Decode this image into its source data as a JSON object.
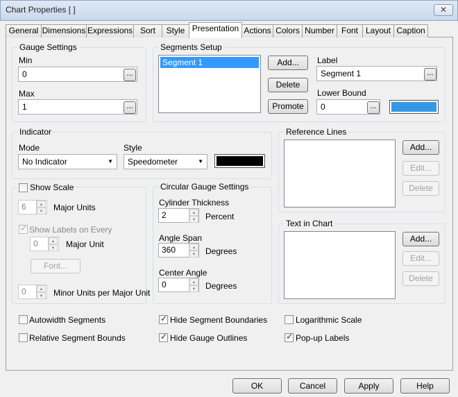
{
  "window": {
    "title": "Chart Properties [ ]",
    "close_label": "✕"
  },
  "tabs": [
    {
      "label": "General"
    },
    {
      "label": "Dimensions"
    },
    {
      "label": "Expressions"
    },
    {
      "label": "Sort"
    },
    {
      "label": "Style"
    },
    {
      "label": "Presentation",
      "selected": true
    },
    {
      "label": "Actions"
    },
    {
      "label": "Colors"
    },
    {
      "label": "Number"
    },
    {
      "label": "Font"
    },
    {
      "label": "Layout"
    },
    {
      "label": "Caption"
    }
  ],
  "gauge_settings": {
    "title": "Gauge Settings",
    "min_label": "Min",
    "min_value": "0",
    "max_label": "Max",
    "max_value": "1",
    "ellipsis": "..."
  },
  "segments": {
    "title": "Segments Setup",
    "items": [
      "Segment 1"
    ],
    "add": "Add...",
    "delete": "Delete",
    "promote": "Promote",
    "label_label": "Label",
    "label_value": "Segment 1",
    "lower_bound_label": "Lower Bound",
    "lower_bound_value": "0",
    "segment_color": "#3399e6"
  },
  "indicator": {
    "title": "Indicator",
    "mode_label": "Mode",
    "mode_value": "No Indicator",
    "style_label": "Style",
    "style_value": "Speedometer",
    "color": "#000000"
  },
  "reference_lines": {
    "title": "Reference Lines",
    "add": "Add...",
    "edit": "Edit...",
    "delete": "Delete"
  },
  "scale": {
    "title": "Show Scale",
    "checked": false,
    "major_units_value": "6",
    "major_units_label": "Major Units",
    "show_labels_label": "Show Labels on Every",
    "show_labels_checked": true,
    "major_unit_value": "0",
    "major_unit_label": "Major Unit",
    "font_button": "Font...",
    "minor_value": "0",
    "minor_label": "Minor Units per Major Unit"
  },
  "circular": {
    "title": "Circular Gauge Settings",
    "thickness_label": "Cylinder Thickness",
    "thickness_value": "2",
    "thickness_unit": "Percent",
    "angle_span_label": "Angle Span",
    "angle_span_value": "360",
    "angle_span_unit": "Degrees",
    "center_angle_label": "Center Angle",
    "center_angle_value": "0",
    "center_angle_unit": "Degrees"
  },
  "text_in_chart": {
    "title": "Text in Chart",
    "add": "Add...",
    "edit": "Edit...",
    "delete": "Delete"
  },
  "options": [
    {
      "label": "Autowidth Segments",
      "checked": false
    },
    {
      "label": "Relative Segment Bounds",
      "checked": false
    },
    {
      "label": "Hide Segment Boundaries",
      "checked": true
    },
    {
      "label": "Hide Gauge Outlines",
      "checked": true
    },
    {
      "label": "Logarithmic Scale",
      "checked": false
    },
    {
      "label": "Pop-up Labels",
      "checked": true
    }
  ],
  "footer": {
    "ok": "OK",
    "cancel": "Cancel",
    "apply": "Apply",
    "help": "Help"
  }
}
